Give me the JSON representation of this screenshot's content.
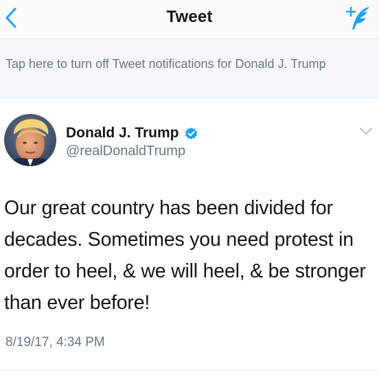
{
  "nav": {
    "title": "Tweet",
    "back_icon": "chevron-left-icon",
    "compose_icon": "compose-tweet-icon",
    "accent_color": "#1da1f2"
  },
  "notification_banner": {
    "text": "Tap here to turn off Tweet notifications for Donald J. Trump"
  },
  "tweet": {
    "author": {
      "display_name": "Donald J. Trump",
      "handle": "@realDonaldTrump",
      "verified": true,
      "avatar_icon": "profile-photo"
    },
    "menu_icon": "chevron-down-icon",
    "text": "Our great country has been divided for decades. Sometimes you need protest in order to heel, & we will heel, & be stronger than ever before!",
    "timestamp": "8/19/17, 4:34 PM"
  }
}
